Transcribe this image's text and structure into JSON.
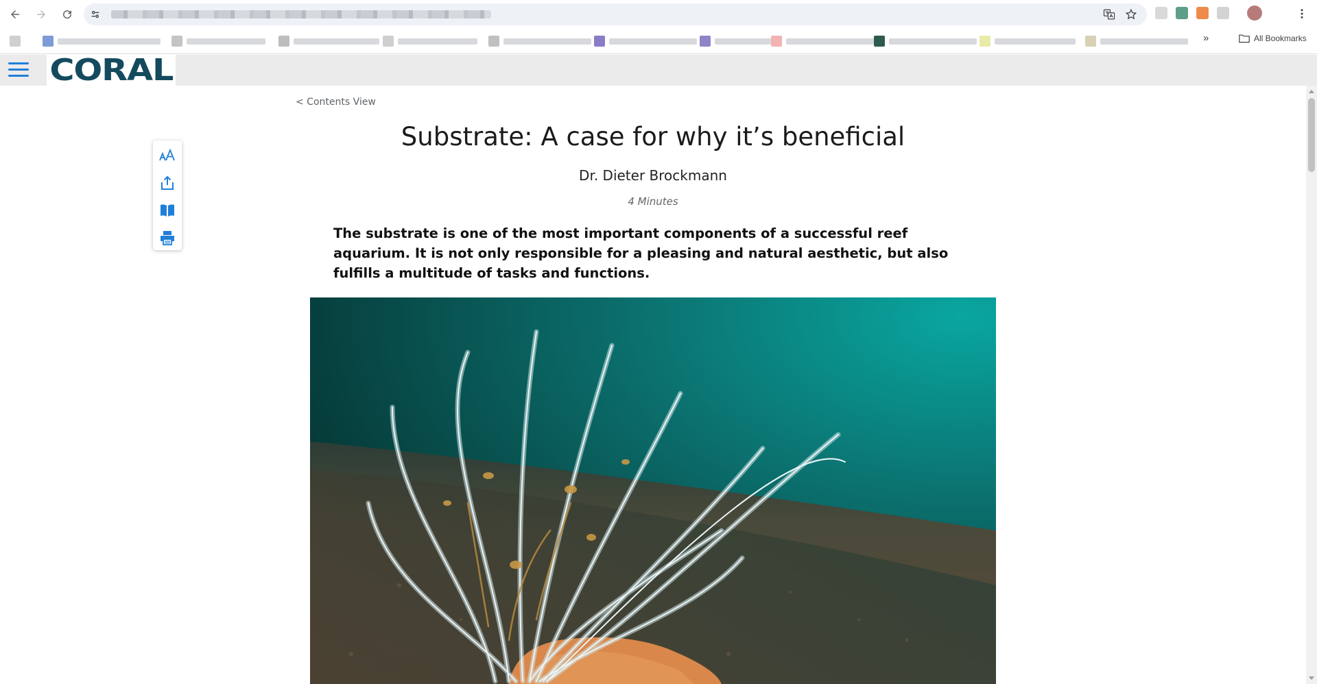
{
  "browser": {
    "back_icon": "arrow-left-icon",
    "forward_icon": "arrow-right-icon",
    "reload_icon": "reload-icon",
    "bookmarks_overflow": "»",
    "all_bookmarks_label": "All Bookmarks"
  },
  "site": {
    "logo_text": "CORAL",
    "brand_color": "#144a5e",
    "accent_color": "#1f7fd8"
  },
  "article": {
    "back_link": "< Contents View",
    "title": "Substrate: A case for why it’s beneficial",
    "author": "Dr. Dieter Brockmann",
    "read_time": "4 Minutes",
    "lead": "The substrate is one of the most important components of a successful reef aquarium. It is not only responsible for a pleasing and natural aesthetic, but also fulfills a multitude of tasks and functions."
  },
  "tools": [
    {
      "name": "text-size-icon"
    },
    {
      "name": "share-icon"
    },
    {
      "name": "book-icon"
    },
    {
      "name": "print-icon"
    }
  ]
}
